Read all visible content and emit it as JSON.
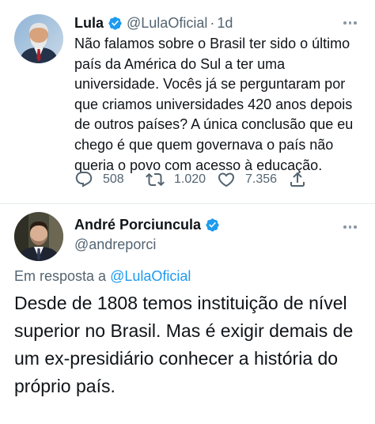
{
  "tweet1": {
    "author_name": "Lula",
    "handle": "@LulaOficial",
    "time": "1d",
    "text": "Não falamos sobre o Brasil ter sido o último país da América do Sul a ter uma universidade. Vocês já se perguntaram por que criamos universidades 420 anos depois de outros países? A única conclusão que eu chego é que quem governava o país não queria o povo com acesso à educação.",
    "replies": "508",
    "retweets": "1.020",
    "likes": "7.356"
  },
  "tweet2": {
    "author_name": "André Porciuncula",
    "handle": "@andreporci",
    "replying_prefix": "Em resposta a",
    "replying_to": "@LulaOficial",
    "text": "Desde de 1808 temos instituição de nível superior no Brasil. Mas é exigir demais de um ex-presidiário conhecer a história do próprio país."
  },
  "icons": {
    "verified": "verified-badge-icon",
    "more": "more-options-icon",
    "reply": "reply-icon",
    "retweet": "retweet-icon",
    "like": "heart-icon",
    "share": "share-icon"
  },
  "colors": {
    "accent": "#1d9bf0",
    "secondary_text": "#536471",
    "primary_text": "#0f1419"
  }
}
